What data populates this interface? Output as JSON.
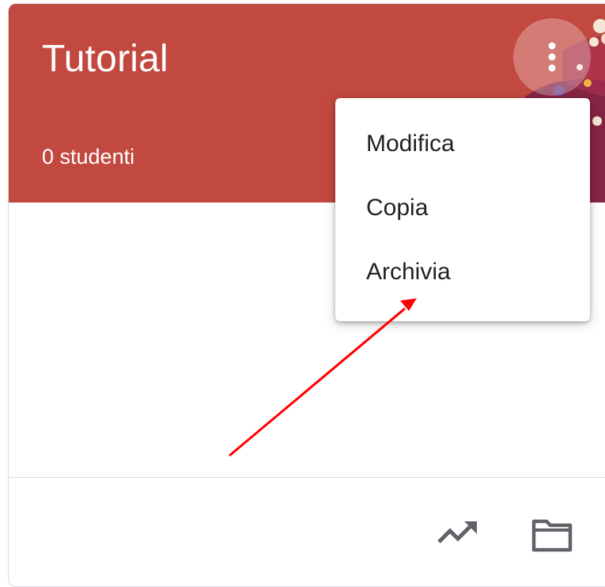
{
  "card": {
    "title": "Tutorial",
    "student_count": "0 studenti"
  },
  "colors": {
    "banner": "#c2493f",
    "annotation_arrow": "#ff0000"
  },
  "more_button": {
    "icon": "more-vert-icon"
  },
  "menu": {
    "items": [
      {
        "label": "Modifica"
      },
      {
        "label": "Copia"
      },
      {
        "label": "Archivia"
      }
    ]
  },
  "footer": {
    "icons": [
      "trending-up-icon",
      "folder-icon"
    ]
  }
}
